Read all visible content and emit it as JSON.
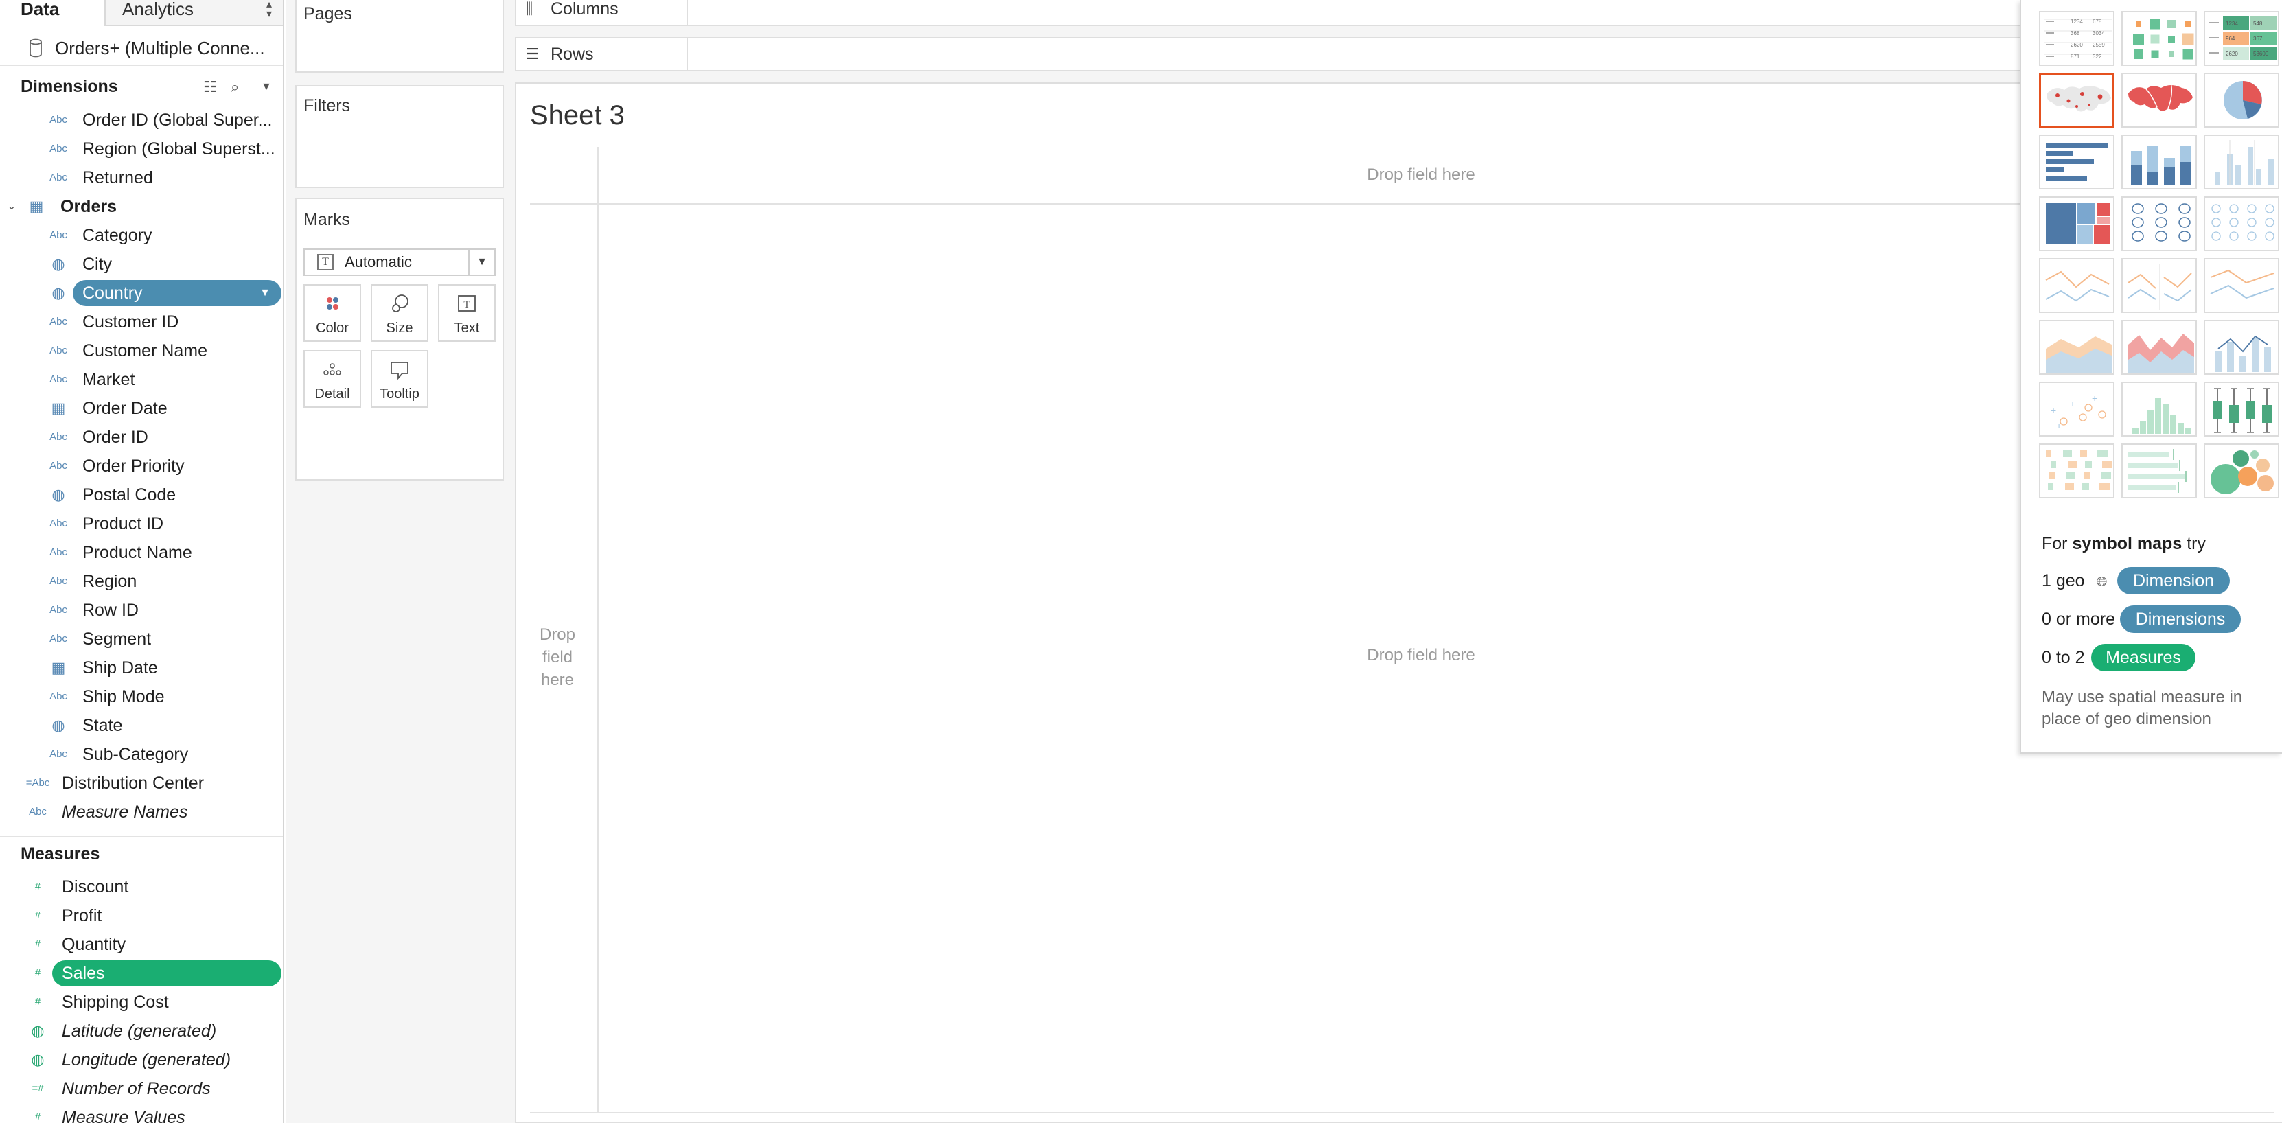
{
  "data_pane": {
    "tab_data": "Data",
    "tab_analytics": "Analytics",
    "connection": "Orders+ (Multiple Conne...",
    "dimensions_heading": "Dimensions",
    "measures_heading": "Measures",
    "dimension_fields": [
      {
        "icon": "Abc",
        "label": "Order ID (Global Super..."
      },
      {
        "icon": "Abc",
        "label": "Region (Global Superst..."
      },
      {
        "icon": "Abc",
        "label": "Returned"
      },
      {
        "icon": "table",
        "label": "Orders"
      },
      {
        "icon": "Abc",
        "label": "Category"
      },
      {
        "icon": "globe",
        "label": "City"
      },
      {
        "icon": "globe",
        "label": "Country"
      },
      {
        "icon": "Abc",
        "label": "Customer ID"
      },
      {
        "icon": "Abc",
        "label": "Customer Name"
      },
      {
        "icon": "Abc",
        "label": "Market"
      },
      {
        "icon": "calendar",
        "label": "Order Date"
      },
      {
        "icon": "Abc",
        "label": "Order ID"
      },
      {
        "icon": "Abc",
        "label": "Order Priority"
      },
      {
        "icon": "globe",
        "label": "Postal Code"
      },
      {
        "icon": "Abc",
        "label": "Product ID"
      },
      {
        "icon": "Abc",
        "label": "Product Name"
      },
      {
        "icon": "Abc",
        "label": "Region"
      },
      {
        "icon": "Abc",
        "label": "Row ID"
      },
      {
        "icon": "Abc",
        "label": "Segment"
      },
      {
        "icon": "calendar",
        "label": "Ship Date"
      },
      {
        "icon": "Abc",
        "label": "Ship Mode"
      },
      {
        "icon": "globe",
        "label": "State"
      },
      {
        "icon": "Abc",
        "label": "Sub-Category"
      },
      {
        "icon": "=Abc",
        "label": "Distribution Center"
      },
      {
        "icon": "Abc",
        "label": "Measure Names"
      }
    ],
    "measure_fields": [
      {
        "icon": "#",
        "label": "Discount"
      },
      {
        "icon": "#",
        "label": "Profit"
      },
      {
        "icon": "#",
        "label": "Quantity"
      },
      {
        "icon": "#",
        "label": "Sales"
      },
      {
        "icon": "#",
        "label": "Shipping Cost"
      },
      {
        "icon": "globe",
        "label": "Latitude (generated)"
      },
      {
        "icon": "globe",
        "label": "Longitude (generated)"
      },
      {
        "icon": "=#",
        "label": "Number of Records"
      },
      {
        "icon": "#",
        "label": "Measure Values"
      }
    ],
    "selected_dimension": "Country",
    "selected_measure": "Sales"
  },
  "shelves": {
    "pages": "Pages",
    "filters": "Filters",
    "marks": "Marks",
    "mark_type": "Automatic",
    "mark_buttons": {
      "color": "Color",
      "size": "Size",
      "text": "Text",
      "detail": "Detail",
      "tooltip": "Tooltip"
    }
  },
  "canvas": {
    "columns": "Columns",
    "rows": "Rows",
    "sheet_title": "Sheet 3",
    "drop_top": "Drop field here",
    "drop_center": "Drop field here",
    "drop_left": "Drop field here"
  },
  "show_me": {
    "hint_prefix": "For",
    "hint_bold": "symbol maps",
    "hint_suffix": "try",
    "row1_label": "1 geo",
    "row1_pill": "Dimension",
    "row2_label": "0 or more",
    "row2_pill": "Dimensions",
    "row3_label": "0 to 2",
    "row3_pill": "Measures",
    "note": "May use spatial measure in place of geo dimension",
    "thumb_text": {
      "table_nums": [
        "1234",
        "678",
        "368",
        "3034",
        "2620",
        "2559",
        "871",
        "322"
      ],
      "highlight_nums": [
        "1234",
        "548",
        "964",
        "367",
        "2620",
        "53600"
      ]
    }
  },
  "colors": {
    "dimension_blue": "#4b8db0",
    "measure_green": "#1aae72",
    "selected_thumb": "#e5511f"
  }
}
